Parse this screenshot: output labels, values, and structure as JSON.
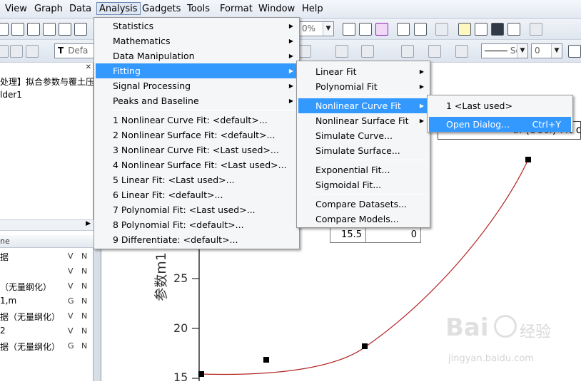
{
  "menubar": {
    "items": [
      "View",
      "Graph",
      "Data",
      "Analysis",
      "Gadgets",
      "Tools",
      "Format",
      "Window",
      "Help"
    ]
  },
  "toolbar": {
    "zoom": "0%",
    "font": "Defa",
    "line_style": "Sc",
    "line_width": "0"
  },
  "left_panel": {
    "title_text": "处理】拟合参数与覆土压",
    "folder": "lder1",
    "column_header": "ne",
    "rows": [
      {
        "name": "据",
        "c1": "V",
        "c2": "N"
      },
      {
        "name": "",
        "c1": "V",
        "c2": "N"
      },
      {
        "name": "（无量纲化）",
        "c1": "V",
        "c2": "N"
      },
      {
        "name": "1,m",
        "c1": "G",
        "c2": "N"
      },
      {
        "name": "据（无量纲化）",
        "c1": "V",
        "c2": "N"
      },
      {
        "name": "2",
        "c1": "V",
        "c2": "N"
      },
      {
        "name": "据（无量纲化）",
        "c1": "G",
        "c2": "N"
      }
    ]
  },
  "analysis_menu": {
    "items": [
      {
        "label": "Statistics",
        "sub": true
      },
      {
        "label": "Mathematics",
        "sub": true
      },
      {
        "label": "Data Manipulation",
        "sub": true
      },
      {
        "label": "Fitting",
        "sub": true,
        "selected": true
      },
      {
        "label": "Signal Processing",
        "sub": true
      },
      {
        "label": "Peaks and Baseline",
        "sub": true
      },
      {
        "label": "1 Nonlinear Curve Fit: <default>..."
      },
      {
        "label": "2 Nonlinear Surface Fit: <default>..."
      },
      {
        "label": "3 Nonlinear Curve Fit: <Last used>..."
      },
      {
        "label": "4 Nonlinear Surface Fit: <Last used>..."
      },
      {
        "label": "5 Linear Fit: <Last used>..."
      },
      {
        "label": "6 Linear Fit: <default>..."
      },
      {
        "label": "7 Polynomial Fit: <Last used>..."
      },
      {
        "label": "8 Polynomial Fit: <default>..."
      },
      {
        "label": "9 Differentiate: <default>..."
      }
    ]
  },
  "fitting_menu": {
    "items": [
      {
        "label": "Linear Fit",
        "sub": true
      },
      {
        "label": "Polynomial Fit",
        "sub": true
      },
      {
        "label": "Nonlinear Curve Fit",
        "sub": true,
        "selected": true
      },
      {
        "label": "Nonlinear Surface Fit",
        "sub": true
      },
      {
        "label": "Simulate Curve..."
      },
      {
        "label": "Simulate Surface..."
      },
      {
        "label": "Exponential Fit..."
      },
      {
        "label": "Sigmoidal Fit..."
      },
      {
        "label": "Compare Datasets..."
      },
      {
        "label": "Compare Models..."
      }
    ]
  },
  "nlfit_menu": {
    "items": [
      {
        "label": "1 <Last used>"
      },
      {
        "label": "Open Dialog...",
        "shortcut": "Ctrl+Y",
        "selected": true
      }
    ]
  },
  "graph": {
    "title_fragment": "al (Sec.) Fit of",
    "table_values": [
      "15.5",
      "0"
    ],
    "ylabel": "参数m1",
    "yticks": [
      "25",
      "20",
      "15"
    ],
    "colors": {
      "curve": "#c0392b",
      "points": "#000000"
    }
  },
  "watermark": {
    "brand": "Bai",
    "brand2": "经验",
    "url": "jingyan.baidu.com"
  }
}
